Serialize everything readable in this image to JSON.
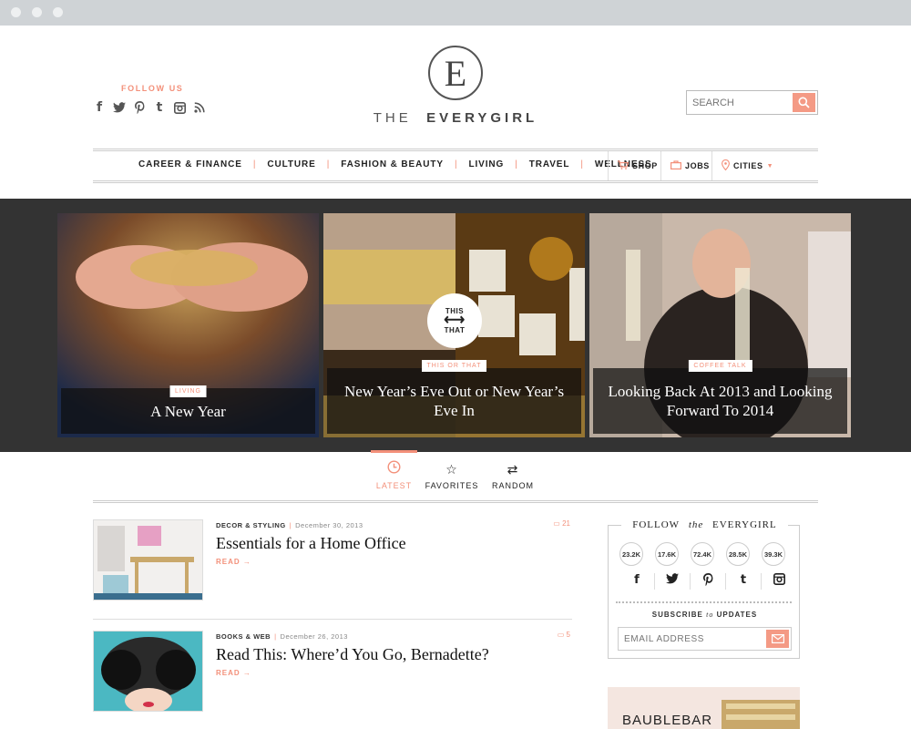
{
  "header": {
    "follow_label": "FOLLOW US",
    "logo_letter": "E",
    "brand_the": "THE",
    "brand_name": "EVERYGIRL",
    "search_placeholder": "SEARCH"
  },
  "nav": {
    "items": [
      "CAREER & FINANCE",
      "CULTURE",
      "FASHION & BEAUTY",
      "LIVING",
      "TRAVEL",
      "WELLNESS"
    ],
    "shop": "SHOP",
    "jobs": "JOBS",
    "cities": "CITIES"
  },
  "hero": [
    {
      "tag": "LIVING",
      "title": "A New Year"
    },
    {
      "tag": "THIS OR THAT",
      "title": "New Year’s Eve Out or New Year’s Eve In",
      "badge_top": "THIS",
      "badge_bottom": "THAT"
    },
    {
      "tag": "COFFEE TALK",
      "title": "Looking Back At 2013 and Looking Forward To 2014"
    }
  ],
  "tabs": [
    {
      "label": "LATEST",
      "icon": "clock-icon"
    },
    {
      "label": "FAVORITES",
      "icon": "star-icon"
    },
    {
      "label": "RANDOM",
      "icon": "shuffle-icon"
    }
  ],
  "articles": [
    {
      "category": "DECOR & STYLING",
      "date": "December 30, 2013",
      "title": "Essentials for a Home Office",
      "read": "READ →",
      "comments": "21"
    },
    {
      "category": "BOOKS & WEB",
      "date": "December 26, 2013",
      "title": "Read This: Where’d You Go, Bernadette?",
      "read": "READ →",
      "comments": "5"
    }
  ],
  "sidebar": {
    "title_prefix": "FOLLOW",
    "title_the": "the",
    "title_name": "EVERYGIRL",
    "counts": [
      "23.2K",
      "17.6K",
      "72.4K",
      "28.5K",
      "39.3K"
    ],
    "subscribe_prefix": "SUBSCRIBE",
    "subscribe_to": "to",
    "subscribe_suffix": "UPDATES",
    "email_placeholder": "EMAIL ADDRESS"
  },
  "ad": {
    "text": "BAUBLEBAR"
  },
  "colors": {
    "accent": "#f3907a",
    "dark_band": "#333333"
  }
}
